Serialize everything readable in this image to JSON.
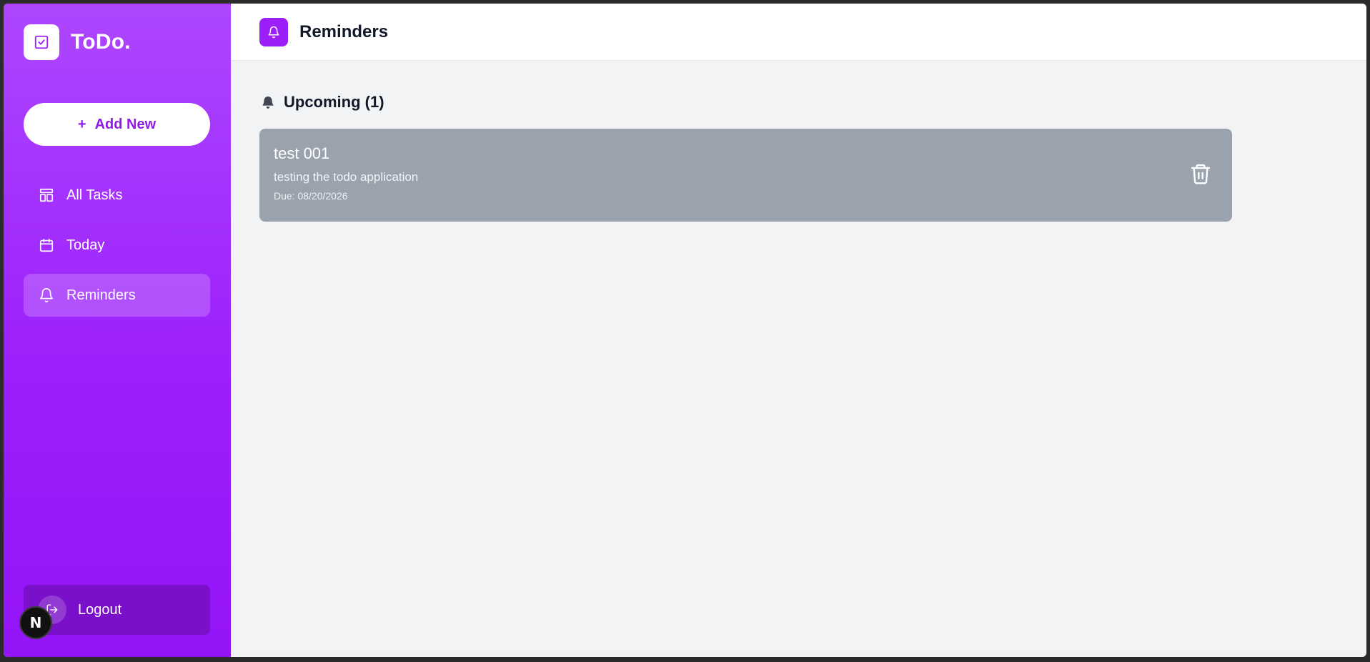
{
  "brand": {
    "title": "ToDo.",
    "icon": "check-square-icon"
  },
  "sidebar": {
    "add_new_label": "Add New",
    "add_new_icon": "+",
    "items": [
      {
        "label": "All Tasks",
        "icon": "layout-icon",
        "active": false
      },
      {
        "label": "Today",
        "icon": "calendar-icon",
        "active": false
      },
      {
        "label": "Reminders",
        "icon": "bell-icon",
        "active": true
      }
    ],
    "logout_label": "Logout",
    "badge_letter": "N"
  },
  "header": {
    "title": "Reminders",
    "icon": "bell-icon"
  },
  "section": {
    "title": "Upcoming (1)",
    "icon": "bell-filled-icon"
  },
  "tasks": [
    {
      "title": "test 001",
      "description": "testing the todo application",
      "due": "Due: 08/20/2026"
    }
  ],
  "colors": {
    "accent": "#9c1ef9",
    "sidebar_top": "#ae46ff",
    "sidebar_bottom": "#9414f8",
    "card_bg": "#9aa2ae",
    "main_bg": "#f2f3f5"
  }
}
